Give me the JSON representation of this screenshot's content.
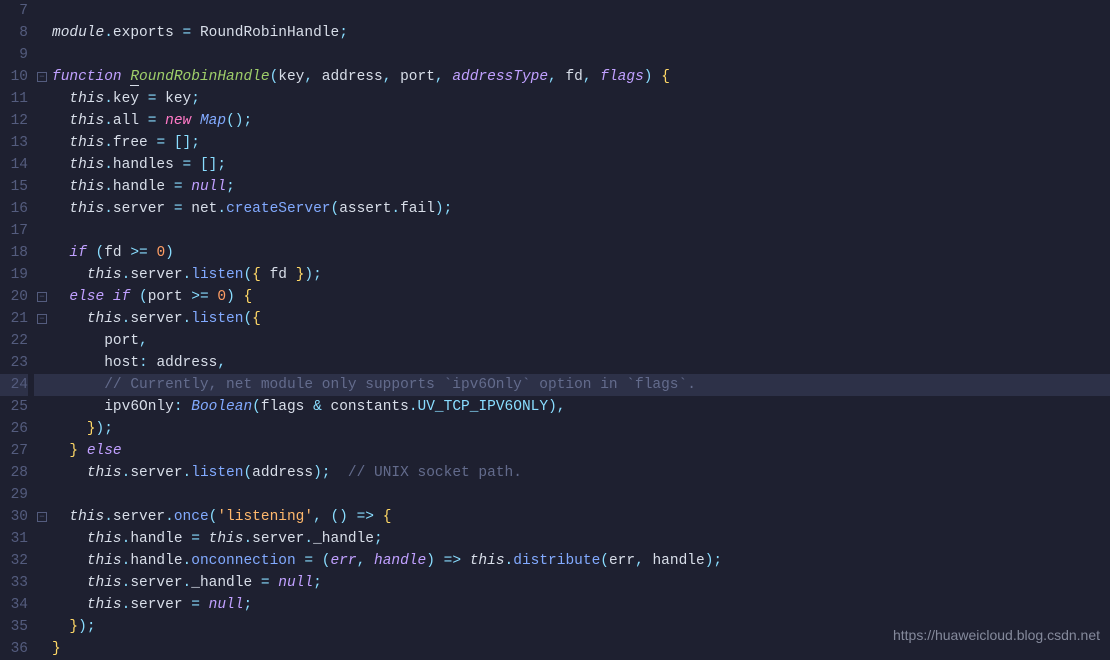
{
  "watermark": "https://huaweicloud.blog.csdn.net",
  "lines": [
    {
      "num": 7,
      "fold": "",
      "raw": ""
    },
    {
      "num": 8,
      "fold": "",
      "raw": "module.exports = RoundRobinHandle;"
    },
    {
      "num": 9,
      "fold": "",
      "raw": ""
    },
    {
      "num": 10,
      "fold": "-",
      "raw": "function RoundRobinHandle(key, address, port, addressType, fd, flags) {"
    },
    {
      "num": 11,
      "fold": "",
      "raw": "  this.key = key;"
    },
    {
      "num": 12,
      "fold": "",
      "raw": "  this.all = new Map();"
    },
    {
      "num": 13,
      "fold": "",
      "raw": "  this.free = [];"
    },
    {
      "num": 14,
      "fold": "",
      "raw": "  this.handles = [];"
    },
    {
      "num": 15,
      "fold": "",
      "raw": "  this.handle = null;"
    },
    {
      "num": 16,
      "fold": "",
      "raw": "  this.server = net.createServer(assert.fail);"
    },
    {
      "num": 17,
      "fold": "",
      "raw": ""
    },
    {
      "num": 18,
      "fold": "",
      "raw": "  if (fd >= 0)"
    },
    {
      "num": 19,
      "fold": "",
      "raw": "    this.server.listen({ fd });"
    },
    {
      "num": 20,
      "fold": "-",
      "raw": "  else if (port >= 0) {"
    },
    {
      "num": 21,
      "fold": "-",
      "raw": "    this.server.listen({"
    },
    {
      "num": 22,
      "fold": "",
      "raw": "      port,"
    },
    {
      "num": 23,
      "fold": "",
      "raw": "      host: address,"
    },
    {
      "num": 24,
      "fold": "",
      "raw": "      // Currently, net module only supports `ipv6Only` option in `flags`."
    },
    {
      "num": 25,
      "fold": "",
      "raw": "      ipv6Only: Boolean(flags & constants.UV_TCP_IPV6ONLY),"
    },
    {
      "num": 26,
      "fold": "",
      "raw": "    });"
    },
    {
      "num": 27,
      "fold": "",
      "raw": "  } else"
    },
    {
      "num": 28,
      "fold": "",
      "raw": "    this.server.listen(address);  // UNIX socket path."
    },
    {
      "num": 29,
      "fold": "",
      "raw": ""
    },
    {
      "num": 30,
      "fold": "-",
      "raw": "  this.server.once('listening', () => {"
    },
    {
      "num": 31,
      "fold": "",
      "raw": "    this.handle = this.server._handle;"
    },
    {
      "num": 32,
      "fold": "",
      "raw": "    this.handle.onconnection = (err, handle) => this.distribute(err, handle);"
    },
    {
      "num": 33,
      "fold": "",
      "raw": "    this.server._handle = null;"
    },
    {
      "num": 34,
      "fold": "",
      "raw": "    this.server = null;"
    },
    {
      "num": 35,
      "fold": "",
      "raw": "  });"
    },
    {
      "num": 36,
      "fold": "",
      "raw": "}"
    }
  ],
  "rendered": {
    "7": "",
    "8": "<span class='tok-var'>module</span><span class='tok-punc'>.</span><span class='tok-prop'>exports</span> <span class='tok-op'>=</span> <span class='tok-id'>RoundRobinHandle</span><span class='tok-punc'>;</span>",
    "9": "",
    "10": "<span class='tok-kw'>function</span> <span class='tok-fn'><span class='under'>R</span>oundRobinHandle</span><span class='tok-punc'>(</span><span class='tok-prop'>key</span><span class='tok-punc'>,</span> <span class='tok-prop'>address</span><span class='tok-punc'>,</span> <span class='tok-prop'>port</span><span class='tok-punc'>,</span> <span class='tok-param'>addressType</span><span class='tok-punc'>,</span> <span class='tok-prop'>fd</span><span class='tok-punc'>,</span> <span class='tok-param'>flags</span><span class='tok-punc'>)</span> <span class='tok-brace'>{</span>",
    "11": "  <span class='tok-this'>this</span><span class='tok-punc'>.</span><span class='tok-prop'>key</span> <span class='tok-op'>=</span> <span class='tok-id'>key</span><span class='tok-punc'>;</span>",
    "12": "  <span class='tok-this'>this</span><span class='tok-punc'>.</span><span class='tok-prop'>all</span> <span class='tok-op'>=</span> <span class='tok-new'>new</span> <span class='tok-type'>Map</span><span class='tok-punc'>()</span><span class='tok-punc'>;</span>",
    "13": "  <span class='tok-this'>this</span><span class='tok-punc'>.</span><span class='tok-prop'>free</span> <span class='tok-op'>=</span> <span class='tok-punc'>[]</span><span class='tok-punc'>;</span>",
    "14": "  <span class='tok-this'>this</span><span class='tok-punc'>.</span><span class='tok-prop'>handles</span> <span class='tok-op'>=</span> <span class='tok-punc'>[]</span><span class='tok-punc'>;</span>",
    "15": "  <span class='tok-this'>this</span><span class='tok-punc'>.</span><span class='tok-prop'>handle</span> <span class='tok-op'>=</span> <span class='tok-null'>null</span><span class='tok-punc'>;</span>",
    "16": "  <span class='tok-this'>this</span><span class='tok-punc'>.</span><span class='tok-prop'>server</span> <span class='tok-op'>=</span> <span class='tok-id'>net</span><span class='tok-punc'>.</span><span class='tok-call'>createServer</span><span class='tok-punc'>(</span><span class='tok-id'>assert</span><span class='tok-punc'>.</span><span class='tok-prop'>fail</span><span class='tok-punc'>)</span><span class='tok-punc'>;</span>",
    "17": "",
    "18": "  <span class='tok-kw'>if</span> <span class='tok-punc'>(</span><span class='tok-id'>fd</span> <span class='tok-op'>&gt;=</span> <span class='tok-num'>0</span><span class='tok-punc'>)</span>",
    "19": "    <span class='tok-this'>this</span><span class='tok-punc'>.</span><span class='tok-prop'>server</span><span class='tok-punc'>.</span><span class='tok-listen'>listen</span><span class='tok-punc'>(</span><span class='tok-brace'>{</span> <span class='tok-id'>fd</span> <span class='tok-brace'>}</span><span class='tok-punc'>)</span><span class='tok-punc'>;</span>",
    "20": "  <span class='tok-kw'>else</span> <span class='tok-kw'>if</span> <span class='tok-punc'>(</span><span class='tok-id'>port</span> <span class='tok-op'>&gt;=</span> <span class='tok-num'>0</span><span class='tok-punc'>)</span> <span class='tok-brace'>{</span>",
    "21": "    <span class='tok-this'>this</span><span class='tok-punc'>.</span><span class='tok-prop'>server</span><span class='tok-punc'>.</span><span class='tok-listen'>listen</span><span class='tok-punc'>(</span><span class='tok-brace'>{</span>",
    "22": "      <span class='tok-id'>port</span><span class='tok-punc'>,</span>",
    "23": "      <span class='tok-prop'>host</span><span class='tok-punc'>:</span> <span class='tok-id'>address</span><span class='tok-punc'>,</span>",
    "24": "      <span class='tok-cmt'>// Currently, net module only supports `ipv6Only` option in `flags`.</span>",
    "25": "      <span class='tok-prop'>ipv6Only</span><span class='tok-punc'>:</span> <span class='tok-type'>Boolean</span><span class='tok-punc'>(</span><span class='tok-id'>flags</span> <span class='tok-op'>&amp;</span> <span class='tok-id'>constants</span><span class='tok-punc'>.</span><span class='tok-const'>UV_TCP_IPV6ONLY</span><span class='tok-punc'>)</span><span class='tok-punc'>,</span>",
    "26": "    <span class='tok-brace'>}</span><span class='tok-punc'>)</span><span class='tok-punc'>;</span>",
    "27": "  <span class='tok-brace'>}</span> <span class='tok-kw'>else</span>",
    "28": "    <span class='tok-this'>this</span><span class='tok-punc'>.</span><span class='tok-prop'>server</span><span class='tok-punc'>.</span><span class='tok-listen'>listen</span><span class='tok-punc'>(</span><span class='tok-id'>address</span><span class='tok-punc'>)</span><span class='tok-punc'>;</span>  <span class='tok-cmt'>// UNIX socket path.</span>",
    "29": "",
    "30": "  <span class='tok-this'>this</span><span class='tok-punc'>.</span><span class='tok-prop'>server</span><span class='tok-punc'>.</span><span class='tok-call'>once</span><span class='tok-punc'>(</span><span class='tok-str'>'listening'</span><span class='tok-punc'>,</span> <span class='tok-punc'>()</span> <span class='tok-op'>=&gt;</span> <span class='tok-brace'>{</span>",
    "31": "    <span class='tok-this'>this</span><span class='tok-punc'>.</span><span class='tok-prop'>handle</span> <span class='tok-op'>=</span> <span class='tok-this'>this</span><span class='tok-punc'>.</span><span class='tok-prop'>server</span><span class='tok-punc'>.</span><span class='tok-prop'>_handle</span><span class='tok-punc'>;</span>",
    "32": "    <span class='tok-this'>this</span><span class='tok-punc'>.</span><span class='tok-prop'>handle</span><span class='tok-punc'>.</span><span class='tok-call'>onconnection</span> <span class='tok-op'>=</span> <span class='tok-punc'>(</span><span class='tok-param'>err</span><span class='tok-punc'>,</span> <span class='tok-param'>handle</span><span class='tok-punc'>)</span> <span class='tok-op'>=&gt;</span> <span class='tok-this'>this</span><span class='tok-punc'>.</span><span class='tok-call'>distribute</span><span class='tok-punc'>(</span><span class='tok-id'>err</span><span class='tok-punc'>,</span> <span class='tok-id'>handle</span><span class='tok-punc'>)</span><span class='tok-punc'>;</span>",
    "33": "    <span class='tok-this'>this</span><span class='tok-punc'>.</span><span class='tok-prop'>server</span><span class='tok-punc'>.</span><span class='tok-prop'>_handle</span> <span class='tok-op'>=</span> <span class='tok-null'>null</span><span class='tok-punc'>;</span>",
    "34": "    <span class='tok-this'>this</span><span class='tok-punc'>.</span><span class='tok-prop'>server</span> <span class='tok-op'>=</span> <span class='tok-null'>null</span><span class='tok-punc'>;</span>",
    "35": "  <span class='tok-brace'>}</span><span class='tok-punc'>)</span><span class='tok-punc'>;</span>",
    "36": "<span class='tok-brace'>}</span>"
  }
}
